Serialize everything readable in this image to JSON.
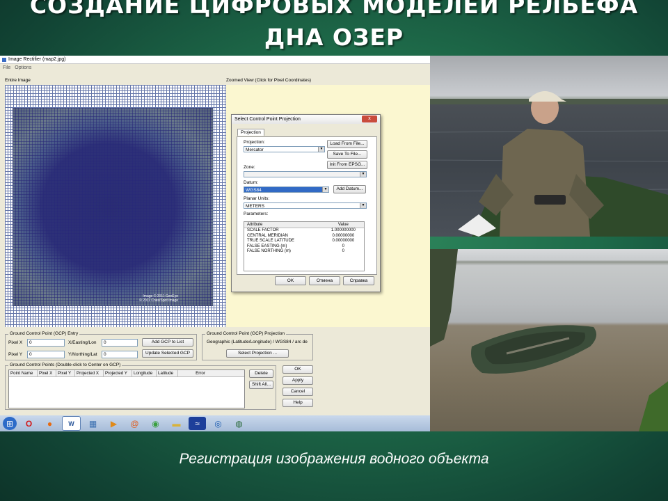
{
  "slide": {
    "title_line1": "СОЗДАНИЕ ЦИФРОВЫХ МОДЕЛЕЙ РЕЛЬЕФА",
    "title_line2": "ДНА ОЗЕР",
    "caption": "Регистрация изображения водного объекта"
  },
  "window": {
    "title": "Image Rectifier (map2.jpg)",
    "menu": [
      "File",
      "Options"
    ],
    "entire_label": "Entire Image",
    "zoomed_label": "Zoomed View (Click for Pixel Coordinates)",
    "image_copyright": [
      "Image © 2011 GeoEye",
      "© 2011 Cnes/Spot Image"
    ]
  },
  "dialog": {
    "title": "Select Control Point Projection",
    "close": "x",
    "tab": "Projection",
    "projection_label": "Projection:",
    "projection_value": "Mercator",
    "load_button": "Load From File...",
    "save_button": "Save To File...",
    "epsg_button": "Init From EPSG...",
    "zone_label": "Zone:",
    "datum_label": "Datum:",
    "datum_value": "WGS84",
    "add_datum_button": "Add Datum...",
    "units_label": "Planar Units:",
    "units_value": "METERS",
    "params_label": "Parameters:",
    "params_header": {
      "attribute": "Attribute",
      "value": "Value"
    },
    "params": [
      {
        "attribute": "SCALE FACTOR",
        "value": "1.000000000"
      },
      {
        "attribute": "CENTRAL MERIDIAN",
        "value": "0.00000000"
      },
      {
        "attribute": "TRUE SCALE LATITUDE",
        "value": "0.00000000"
      },
      {
        "attribute": "FALSE EASTING (m)",
        "value": "0"
      },
      {
        "attribute": "FALSE NORTHING (m)",
        "value": "0"
      }
    ],
    "ok": "OK",
    "cancel": "Отмена",
    "help": "Справка"
  },
  "gcp_entry": {
    "title": "Ground Control Point (GCP) Entry",
    "pixel_x_label": "Pixel X",
    "pixel_x": "0",
    "pixel_y_label": "Pixel Y",
    "pixel_y": "0",
    "x_label": "X/Easting/Lon",
    "x_value": "0",
    "y_label": "Y/Northing/Lat",
    "y_value": "0",
    "add_button": "Add GCP to List",
    "update_button": "Update Selected GCP"
  },
  "gcp_projection": {
    "title": "Ground Control Point (GCP) Projection",
    "value": "Geographic (Latitude/Longitude) / WGS84 / arc de",
    "select_button": "Select Projection ..."
  },
  "gcp_list": {
    "title": "Ground Control Points (Double-click to Center on GCP)",
    "columns": [
      "Point Name",
      "Pixel X",
      "Pixel Y",
      "Projected X",
      "Projected Y",
      "Longitude",
      "Latitude",
      "Error"
    ],
    "delete": "Delete",
    "shift_all": "Shift All..."
  },
  "side_buttons": {
    "ok": "OK",
    "apply": "Apply",
    "cancel": "Cancel",
    "help": "Help"
  },
  "taskbar": [
    "windows-start-icon",
    "opera-icon",
    "firefox-icon",
    "word-icon",
    "calculator-icon",
    "media-player-icon",
    "mail-icon",
    "green-app-icon",
    "folder-icon",
    "wave-app-icon",
    "magnifier-icon",
    "globe-icon"
  ]
}
